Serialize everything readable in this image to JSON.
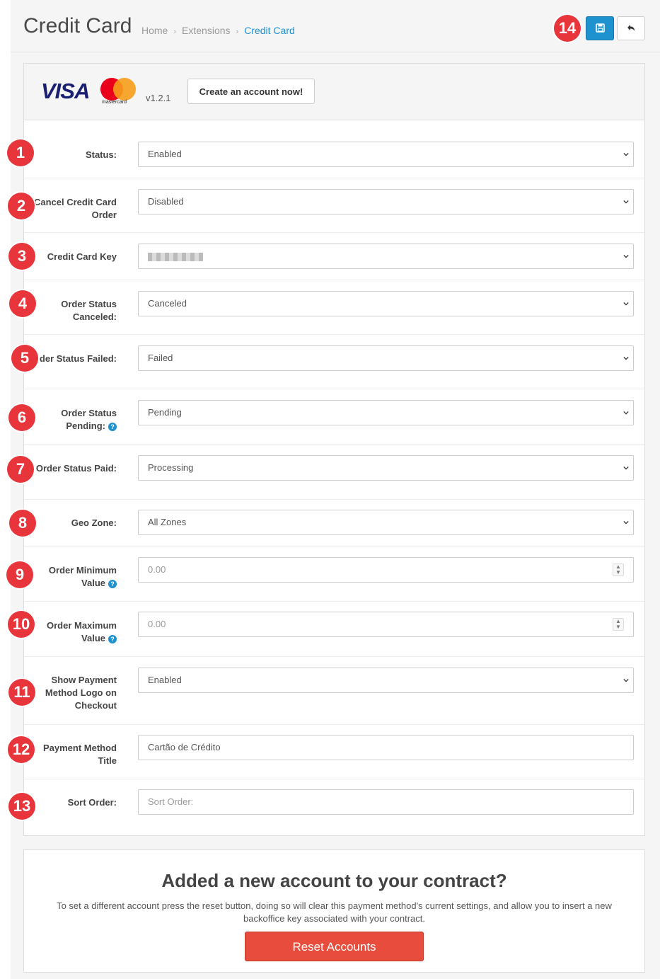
{
  "header": {
    "title": "Credit Card",
    "breadcrumb": [
      "Home",
      "Extensions",
      "Credit Card"
    ],
    "save_icon": "save-icon",
    "back_icon": "reply-icon",
    "primary_color": "#1e91cf"
  },
  "panel": {
    "brand_visa": "VISA",
    "brand_mastercard": "mastercard",
    "version": "v1.2.1",
    "create_account_label": "Create an account now!"
  },
  "form": {
    "fields": [
      {
        "label": "Status:",
        "value": "Enabled"
      },
      {
        "label": "Cancel Credit Card Order",
        "value": "Disabled"
      },
      {
        "label": "Credit Card Key",
        "value": ""
      },
      {
        "label": "Order Status Canceled:",
        "value": "Canceled"
      },
      {
        "label": "Order Status Failed:",
        "value": "Failed"
      },
      {
        "label": "Order Status Pending:",
        "value": "Pending"
      },
      {
        "label": "Order Status Paid:",
        "value": "Processing"
      },
      {
        "label": "Geo Zone:",
        "value": "All Zones"
      },
      {
        "label": "Order Minimum Value",
        "placeholder": "0.00"
      },
      {
        "label": "Order Maximum Value",
        "placeholder": "0.00"
      },
      {
        "label": "Show Payment Method Logo on Checkout",
        "value": "Enabled"
      },
      {
        "label": "Payment Method Title",
        "value": "Cartão de Crédito"
      },
      {
        "label": "Sort Order:",
        "placeholder": "Sort Order:"
      }
    ]
  },
  "reset_panel": {
    "title": "Added a new account to your contract?",
    "text": "To set a different account press the reset button, doing so will clear this payment method's current settings, and allow you to insert a new backoffice key associated with your contract.",
    "button_label": "Reset Accounts",
    "button_color": "#e74c3c"
  },
  "annotations": [
    "1",
    "2",
    "3",
    "4",
    "5",
    "6",
    "7",
    "8",
    "9",
    "10",
    "11",
    "12",
    "13",
    "14"
  ],
  "annotation_color": "#e8343b"
}
